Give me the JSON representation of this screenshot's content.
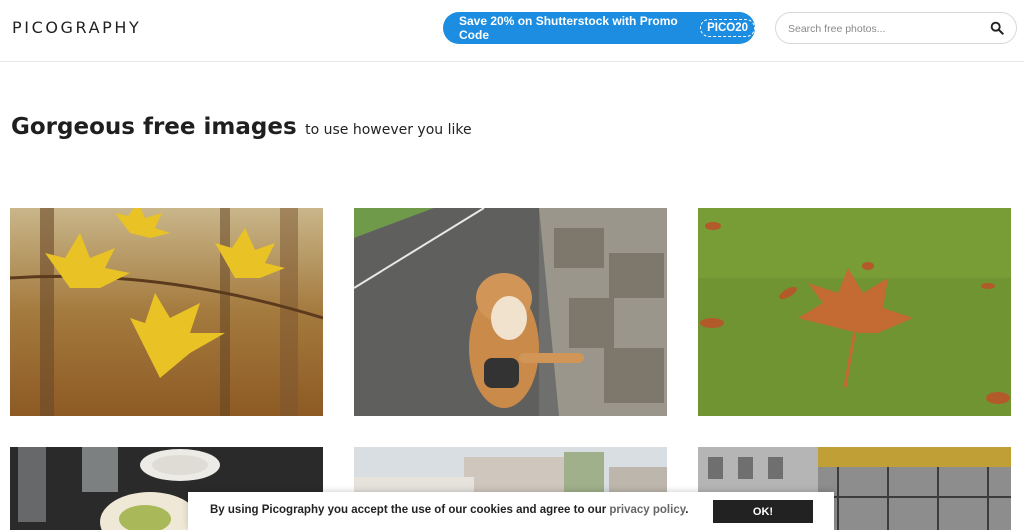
{
  "header": {
    "logo": "PICOGRAPHY",
    "promo": {
      "text": "Save 20% on Shutterstock with Promo Code",
      "code": "PICO20"
    },
    "search": {
      "placeholder": "Search free photos...",
      "value": ""
    }
  },
  "hero": {
    "title": "Gorgeous free images",
    "subtitle": "to use however you like"
  },
  "cookie_banner": {
    "text": "By using Picography you accept the use of our cookies and agree to our",
    "link": "privacy policy",
    "suffix": ".",
    "button": "OK!"
  },
  "colors": {
    "accent": "#1c8de0",
    "text": "#1f1f1f",
    "button_dark": "#222222"
  },
  "icons": {
    "search": "magnifier-icon"
  }
}
